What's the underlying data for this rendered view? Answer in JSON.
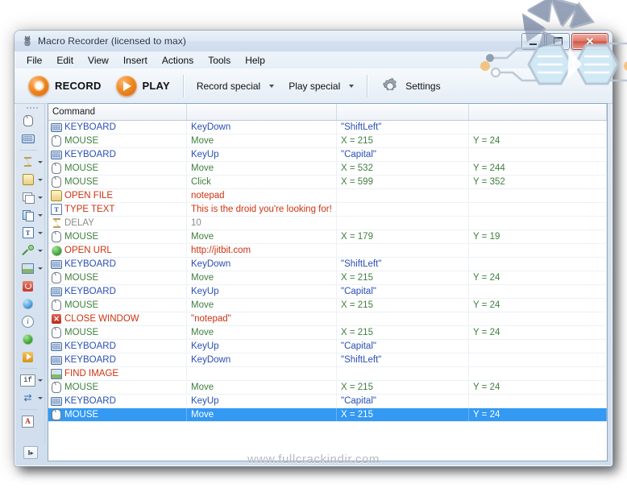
{
  "window": {
    "title": "Macro Recorder (licensed to max)",
    "title_icon": "robot-icon",
    "buttons": {
      "minimize": "–",
      "maximize": "□",
      "close": "✕"
    }
  },
  "menubar": {
    "items": [
      "File",
      "Edit",
      "View",
      "Insert",
      "Actions",
      "Tools",
      "Help"
    ]
  },
  "toolbar": {
    "record_label": "RECORD",
    "play_label": "PLAY",
    "record_special_label": "Record special",
    "play_special_label": "Play special",
    "settings_label": "Settings"
  },
  "sidebar": {
    "items": [
      {
        "icon": "mouse-icon",
        "name": "mouse",
        "caret": false
      },
      {
        "icon": "keyboard-icon",
        "name": "keyboard",
        "caret": false
      },
      {
        "sep": true
      },
      {
        "icon": "hourglass-icon",
        "name": "delay",
        "caret": true
      },
      {
        "icon": "open-file-icon",
        "name": "open-file",
        "caret": true
      },
      {
        "icon": "window-icon",
        "name": "window",
        "caret": true
      },
      {
        "icon": "copy-icon",
        "name": "copy",
        "caret": true
      },
      {
        "icon": "type-text-icon",
        "name": "type-text",
        "caret": true
      },
      {
        "icon": "pipette-icon",
        "name": "color-picker",
        "caret": true
      },
      {
        "icon": "find-image-icon",
        "name": "find-image",
        "caret": true
      },
      {
        "icon": "shutdown-icon",
        "name": "shutdown",
        "caret": false
      },
      {
        "icon": "network-globe-icon",
        "name": "network",
        "caret": false
      },
      {
        "icon": "info-icon",
        "name": "info",
        "caret": false
      },
      {
        "icon": "open-url-icon",
        "name": "open-url",
        "caret": false
      },
      {
        "icon": "run-icon",
        "name": "run",
        "caret": false
      },
      {
        "sep": true
      },
      {
        "icon": "if-icon",
        "name": "if-condition",
        "caret": true
      },
      {
        "icon": "loop-icon",
        "name": "loop",
        "caret": true
      },
      {
        "sep": true
      },
      {
        "icon": "font-a-icon",
        "name": "text-style",
        "caret": false
      }
    ],
    "expand_label": "‖▸"
  },
  "grid": {
    "headers": [
      "Command",
      "",
      "",
      ""
    ],
    "colors": {
      "mouse": "#3f7f3f",
      "keyboard": "#2a4fb5",
      "action": "#cc3311",
      "delay": "#8a8a8a",
      "selected_bg": "#3399f3"
    },
    "rows": [
      {
        "icon": "keyboard-icon",
        "type": "keyboard",
        "command": "KEYBOARD",
        "arg1": "KeyDown",
        "arg2": "\"ShiftLeft\"",
        "arg3": ""
      },
      {
        "icon": "mouse-icon",
        "type": "mouse",
        "command": "MOUSE",
        "arg1": "Move",
        "arg2": "X = 215",
        "arg3": "Y = 24"
      },
      {
        "icon": "keyboard-icon",
        "type": "keyboard",
        "command": "KEYBOARD",
        "arg1": "KeyUp",
        "arg2": "\"Capital\"",
        "arg3": ""
      },
      {
        "icon": "mouse-icon",
        "type": "mouse",
        "command": "MOUSE",
        "arg1": "Move",
        "arg2": "X = 532",
        "arg3": "Y = 244"
      },
      {
        "icon": "mouse-icon",
        "type": "mouse",
        "command": "MOUSE",
        "arg1": "Click",
        "arg2": "X = 599",
        "arg3": "Y = 352"
      },
      {
        "icon": "open-file-icon",
        "type": "action",
        "command": "OPEN FILE",
        "arg1": "notepad",
        "arg2": "",
        "arg3": ""
      },
      {
        "icon": "type-text-icon",
        "type": "action",
        "command": "TYPE TEXT",
        "arg1": "This is the droid you're looking for!",
        "arg2": "",
        "arg3": ""
      },
      {
        "icon": "hourglass-icon",
        "type": "delay",
        "command": "DELAY",
        "arg1": "10",
        "arg2": "",
        "arg3": ""
      },
      {
        "icon": "mouse-icon",
        "type": "mouse",
        "command": "MOUSE",
        "arg1": "Move",
        "arg2": "X = 179",
        "arg3": "Y = 19"
      },
      {
        "icon": "open-url-icon",
        "type": "action",
        "command": "OPEN URL",
        "arg1": "http://jitbit.com",
        "arg2": "",
        "arg3": ""
      },
      {
        "icon": "keyboard-icon",
        "type": "keyboard",
        "command": "KEYBOARD",
        "arg1": "KeyDown",
        "arg2": "\"ShiftLeft\"",
        "arg3": ""
      },
      {
        "icon": "mouse-icon",
        "type": "mouse",
        "command": "MOUSE",
        "arg1": "Move",
        "arg2": "X = 215",
        "arg3": "Y = 24"
      },
      {
        "icon": "keyboard-icon",
        "type": "keyboard",
        "command": "KEYBOARD",
        "arg1": "KeyUp",
        "arg2": "\"Capital\"",
        "arg3": ""
      },
      {
        "icon": "mouse-icon",
        "type": "mouse",
        "command": "MOUSE",
        "arg1": "Move",
        "arg2": "X = 215",
        "arg3": "Y = 24"
      },
      {
        "icon": "close-window-icon",
        "type": "action",
        "command": "CLOSE WINDOW",
        "arg1": "\"notepad\"",
        "arg2": "",
        "arg3": ""
      },
      {
        "icon": "mouse-icon",
        "type": "mouse",
        "command": "MOUSE",
        "arg1": "Move",
        "arg2": "X = 215",
        "arg3": "Y = 24"
      },
      {
        "icon": "keyboard-icon",
        "type": "keyboard",
        "command": "KEYBOARD",
        "arg1": "KeyUp",
        "arg2": "\"Capital\"",
        "arg3": ""
      },
      {
        "icon": "keyboard-icon",
        "type": "keyboard",
        "command": "KEYBOARD",
        "arg1": "KeyDown",
        "arg2": "\"ShiftLeft\"",
        "arg3": ""
      },
      {
        "icon": "find-image-icon",
        "type": "action",
        "command": "FIND IMAGE",
        "arg1": "",
        "arg2": "",
        "arg3": ""
      },
      {
        "icon": "mouse-icon",
        "type": "mouse",
        "command": "MOUSE",
        "arg1": "Move",
        "arg2": "X = 215",
        "arg3": "Y = 24"
      },
      {
        "icon": "keyboard-icon",
        "type": "keyboard",
        "command": "KEYBOARD",
        "arg1": "KeyUp",
        "arg2": "\"Capital\"",
        "arg3": ""
      },
      {
        "icon": "mouse-icon",
        "type": "mouse",
        "command": "MOUSE",
        "arg1": "Move",
        "arg2": "X = 215",
        "arg3": "Y = 24",
        "selected": true
      }
    ]
  },
  "watermark": {
    "text": "www.fullcrackindir.com"
  }
}
